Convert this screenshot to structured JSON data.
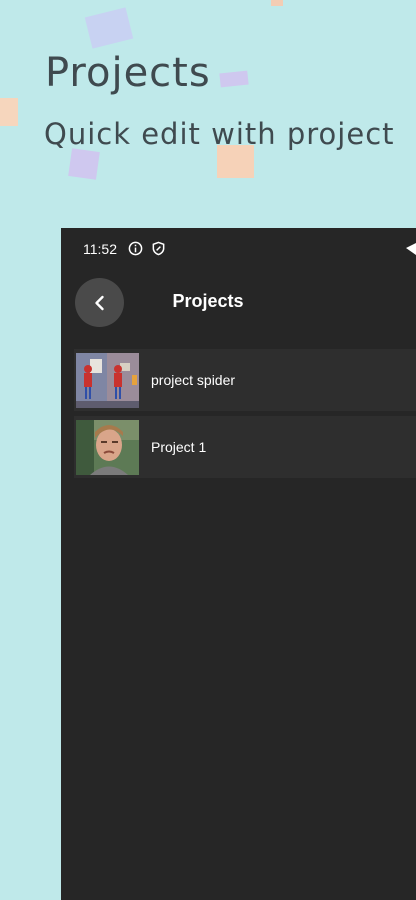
{
  "hero": {
    "title": "Projects",
    "subtitle": "Quick edit with project"
  },
  "status_bar": {
    "time": "11:52",
    "icons": [
      "info-icon",
      "shield-icon",
      "wifi-icon"
    ]
  },
  "app_bar": {
    "title": "Projects",
    "back_icon": "chevron-left-icon"
  },
  "projects": [
    {
      "name": "project spider"
    },
    {
      "name": "Project 1"
    }
  ],
  "colors": {
    "background": "#bfe9ea",
    "phone_bg": "#262626",
    "row_bg": "#2e2e2e",
    "back_button_bg": "#4a4a4a",
    "hero_text": "#3f4a4f"
  }
}
